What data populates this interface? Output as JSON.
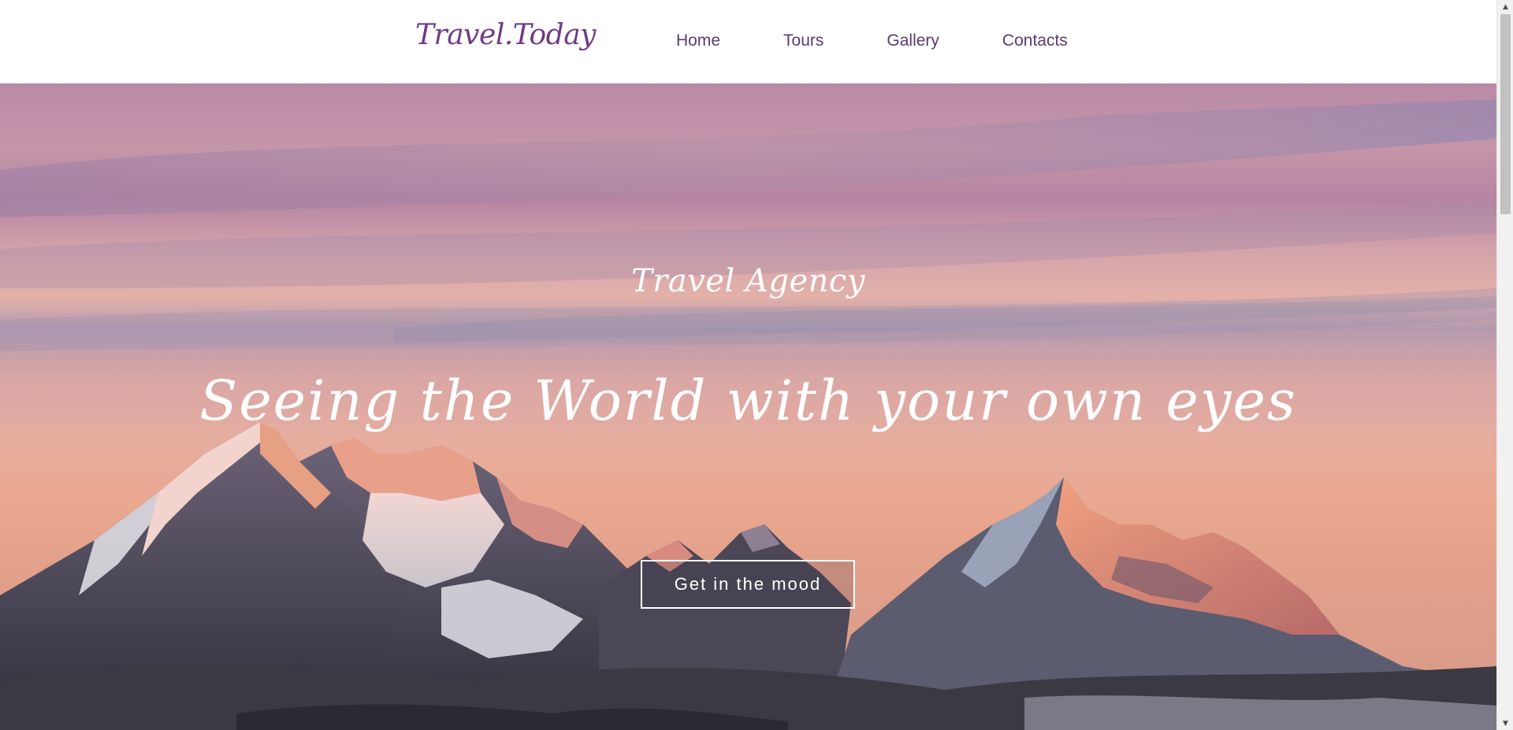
{
  "header": {
    "logo": "Travel.Today",
    "nav": [
      {
        "label": "Home"
      },
      {
        "label": "Tours"
      },
      {
        "label": "Gallery"
      },
      {
        "label": "Contacts"
      }
    ]
  },
  "hero": {
    "subtitle": "Travel Agency",
    "headline": "Seeing the World with your own eyes",
    "cta_label": "Get in the mood"
  },
  "scrollbar": {
    "up_icon": "▲",
    "down_icon": "▼"
  },
  "colors": {
    "brand": "#6f3a86",
    "nav_text": "#5b3a78",
    "hero_text": "#ffffff"
  }
}
